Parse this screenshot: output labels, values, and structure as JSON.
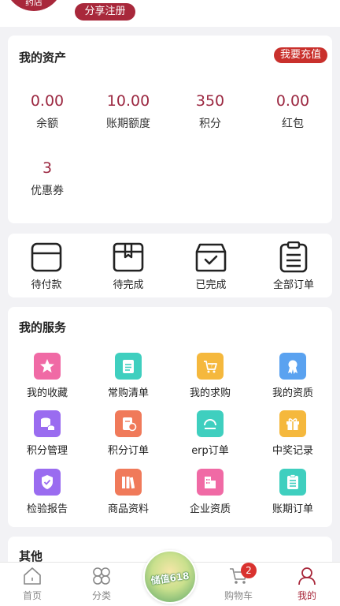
{
  "header": {
    "store_label": "药店",
    "share_register_button": "分享注册"
  },
  "assets": {
    "title": "我的资产",
    "recharge_button": "我要充值",
    "items": [
      {
        "value": "0.00",
        "label": "余额"
      },
      {
        "value": "10.00",
        "label": "账期额度"
      },
      {
        "value": "350",
        "label": "积分"
      },
      {
        "value": "0.00",
        "label": "红包"
      },
      {
        "value": "3",
        "label": "优惠券"
      }
    ]
  },
  "orders": {
    "items": [
      {
        "label": "待付款",
        "icon": "wallet-icon"
      },
      {
        "label": "待完成",
        "icon": "package-icon"
      },
      {
        "label": "已完成",
        "icon": "box-check-icon"
      },
      {
        "label": "全部订单",
        "icon": "clipboard-list-icon"
      }
    ]
  },
  "services": {
    "title": "我的服务",
    "items": [
      {
        "label": "我的收藏",
        "icon": "star-icon",
        "color": "#f06aa5"
      },
      {
        "label": "常购清单",
        "icon": "list-icon",
        "color": "#3fcfbf"
      },
      {
        "label": "我的求购",
        "icon": "cart-question-icon",
        "color": "#f5b83d"
      },
      {
        "label": "我的资质",
        "icon": "certificate-icon",
        "color": "#5aa2f0"
      },
      {
        "label": "积分管理",
        "icon": "coins-icon",
        "color": "#9a6cf0"
      },
      {
        "label": "积分订单",
        "icon": "points-order-icon",
        "color": "#f07a5a"
      },
      {
        "label": "erp订单",
        "icon": "erp-icon",
        "color": "#3fcfbf"
      },
      {
        "label": "中奖记录",
        "icon": "gift-icon",
        "color": "#f5b83d"
      },
      {
        "label": "检验报告",
        "icon": "shield-check-icon",
        "color": "#9a6cf0"
      },
      {
        "label": "商品资料",
        "icon": "books-icon",
        "color": "#f07a5a"
      },
      {
        "label": "企业资质",
        "icon": "building-icon",
        "color": "#f06aa5"
      },
      {
        "label": "账期订单",
        "icon": "ledger-icon",
        "color": "#3fcfbf"
      }
    ]
  },
  "other": {
    "title": "其他"
  },
  "tabbar": {
    "items": [
      {
        "label": "首页",
        "icon": "home-icon"
      },
      {
        "label": "分类",
        "icon": "category-icon"
      },
      {
        "label": "购物车",
        "icon": "cart-icon",
        "badge": "2"
      },
      {
        "label": "我的",
        "icon": "user-icon",
        "active": true
      }
    ],
    "promo_text": "储值618"
  },
  "colors": {
    "brand": "#a8283b",
    "value_red": "#9b2740",
    "recharge": "#c9302c",
    "badge": "#d9322f"
  }
}
